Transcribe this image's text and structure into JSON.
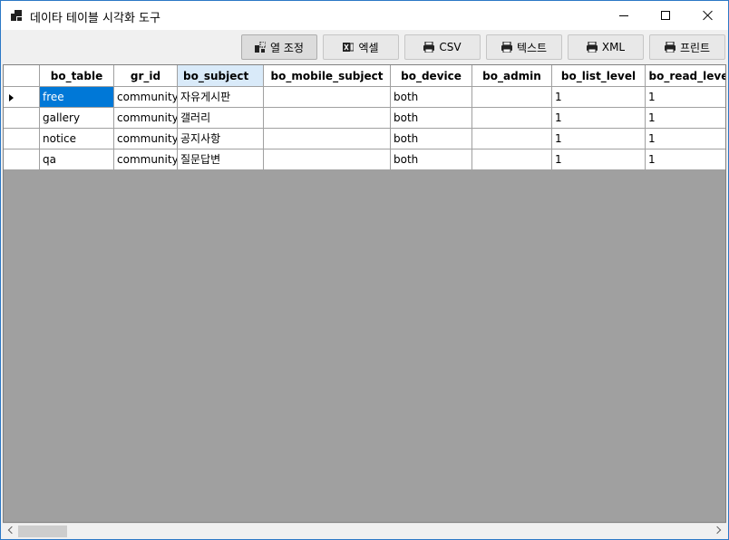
{
  "window": {
    "title": "데이타 테이블 시각화 도구"
  },
  "toolbar": {
    "buttons": [
      {
        "label": "열 조정",
        "icon": "column-adjust-icon"
      },
      {
        "label": "엑셀",
        "icon": "excel-icon"
      },
      {
        "label": "CSV",
        "icon": "csv-icon"
      },
      {
        "label": "텍스트",
        "icon": "text-icon"
      },
      {
        "label": "XML",
        "icon": "xml-icon"
      },
      {
        "label": "프린트",
        "icon": "printer-icon"
      }
    ]
  },
  "grid": {
    "columns": [
      "bo_table",
      "gr_id",
      "bo_subject",
      "bo_mobile_subject",
      "bo_device",
      "bo_admin",
      "bo_list_level",
      "bo_read_level"
    ],
    "sorted_column": "bo_subject",
    "rows": [
      [
        "free",
        "community",
        "자유게시판",
        "",
        "both",
        "",
        "1",
        "1"
      ],
      [
        "gallery",
        "community",
        "갤러리",
        "",
        "both",
        "",
        "1",
        "1"
      ],
      [
        "notice",
        "community",
        "공지사항",
        "",
        "both",
        "",
        "1",
        "1"
      ],
      [
        "qa",
        "community",
        "질문답변",
        "",
        "both",
        "",
        "1",
        "1"
      ]
    ],
    "current_row": 0,
    "selected_cell": [
      0,
      0
    ]
  },
  "colors": {
    "selection": "#0078d7",
    "sorted_header": "#d9eaf9",
    "grid_background": "#a0a0a0",
    "window_border": "#2b78c6"
  }
}
